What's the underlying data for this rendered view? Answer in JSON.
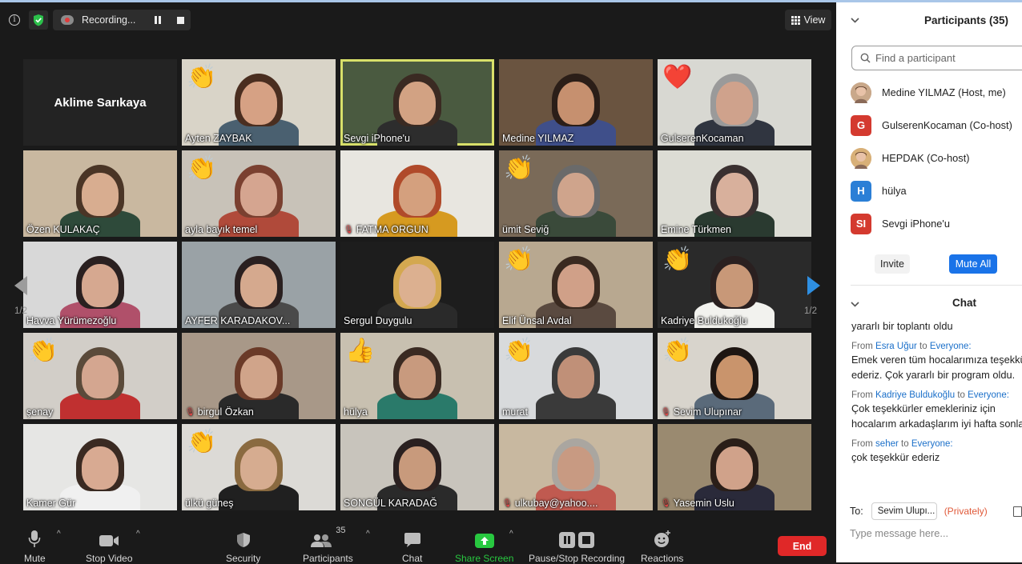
{
  "recording": {
    "label": "Recording...",
    "info_icon": "info-icon",
    "encrypt_icon": "shield-check-icon"
  },
  "view_button": {
    "label": "View"
  },
  "colors": {
    "accent": "#1a73e8",
    "end": "#e02828",
    "share_green": "#28c840",
    "active_border": "#d8e06a",
    "mute_red": "#e04848"
  },
  "tiles": [
    {
      "name": "Aklime Sarıkaya",
      "type": "name-only",
      "muted": false,
      "emoji": ""
    },
    {
      "name": "Ayten ZAYBAK",
      "muted": false,
      "emoji": "👏"
    },
    {
      "name": "Sevgi iPhone'u",
      "muted": false,
      "emoji": "",
      "active": true
    },
    {
      "name": "Medine YILMAZ",
      "muted": false,
      "emoji": ""
    },
    {
      "name": "GulserenKocaman",
      "muted": false,
      "emoji": "❤️"
    },
    {
      "name": "Özen KULAKAÇ",
      "muted": false,
      "emoji": ""
    },
    {
      "name": "ayla bayık temel",
      "muted": false,
      "emoji": "👏"
    },
    {
      "name": "FATMA ORGUN",
      "muted": true,
      "emoji": ""
    },
    {
      "name": "ümit Seviğ",
      "muted": false,
      "emoji": "👏"
    },
    {
      "name": "Emine Türkmen",
      "muted": false,
      "emoji": ""
    },
    {
      "name": "Havva Yürümezoğlu",
      "muted": false,
      "emoji": ""
    },
    {
      "name": "AYFER KARADAKOV...",
      "muted": false,
      "emoji": ""
    },
    {
      "name": "Sergul Duygulu",
      "muted": false,
      "emoji": ""
    },
    {
      "name": "Elif Ünsal Avdal",
      "muted": false,
      "emoji": "👏"
    },
    {
      "name": "Kadriye Buldukoğlu",
      "muted": false,
      "emoji": "👏"
    },
    {
      "name": "şenay",
      "muted": false,
      "emoji": "👏"
    },
    {
      "name": "birgul Özkan",
      "muted": true,
      "emoji": ""
    },
    {
      "name": "hülya",
      "muted": false,
      "emoji": "👍"
    },
    {
      "name": "murat",
      "muted": false,
      "emoji": "👏"
    },
    {
      "name": "Sevim Ulupınar",
      "muted": true,
      "emoji": "👏"
    },
    {
      "name": "Kamer Gür",
      "muted": false,
      "emoji": ""
    },
    {
      "name": "ülkü güneş",
      "muted": false,
      "emoji": "👏"
    },
    {
      "name": "SONGÜL KARADAĞ",
      "muted": false,
      "emoji": ""
    },
    {
      "name": "ulkubay@yahoo....",
      "muted": true,
      "emoji": ""
    },
    {
      "name": "Yasemin Uslu",
      "muted": true,
      "emoji": ""
    }
  ],
  "pagination": {
    "left": "1/2",
    "right": "1/2"
  },
  "toolbar": {
    "mute": "Mute",
    "stop_video": "Stop Video",
    "security": "Security",
    "participants": "Participants",
    "participants_count": "35",
    "chat": "Chat",
    "share_screen": "Share Screen",
    "pause_stop_recording": "Pause/Stop Recording",
    "reactions": "Reactions",
    "end": "End"
  },
  "sidebar": {
    "title": "Participants (35)",
    "search_placeholder": "Find a participant",
    "participants": [
      {
        "name": "Medine YILMAZ (Host, me)",
        "avatar": "photo",
        "initials": "",
        "color": "#c9a88a"
      },
      {
        "name": "GulserenKocaman (Co-host)",
        "avatar": "initials",
        "initials": "G",
        "color": "#d43a2f"
      },
      {
        "name": "HEPDAK (Co-host)",
        "avatar": "photo",
        "initials": "",
        "color": "#d8b078"
      },
      {
        "name": "hülya",
        "avatar": "initials",
        "initials": "H",
        "color": "#2b7fd6"
      },
      {
        "name": "Sevgi iPhone'u",
        "avatar": "initials",
        "initials": "SI",
        "color": "#d43a2f"
      }
    ],
    "invite": "Invite",
    "mute_all": "Mute All",
    "chat_title": "Chat",
    "chat": [
      {
        "from": "",
        "to": "",
        "text": [
          "yararlı bir toplantı oldu"
        ]
      },
      {
        "from": "Esra Uğur",
        "to": "Everyone:",
        "text": [
          "Emek veren tüm hocalarımıza teşekkür",
          "ederiz. Çok yararlı bir program oldu."
        ]
      },
      {
        "from": "Kadriye Buldukoğlu",
        "to": "Everyone:",
        "text": [
          "Çok teşekkürler emekleriniz için",
          "hocalarım arkadaşlarım iyi hafta sonları"
        ]
      },
      {
        "from": "seher",
        "to": "Everyone:",
        "text": [
          "çok teşekkür ederiz"
        ]
      }
    ],
    "from_word": "From",
    "to_word": "to",
    "to_label": "To:",
    "to_value": "Sevim Ulupı...",
    "privately": "(Privately)",
    "type_placeholder": "Type message here..."
  }
}
